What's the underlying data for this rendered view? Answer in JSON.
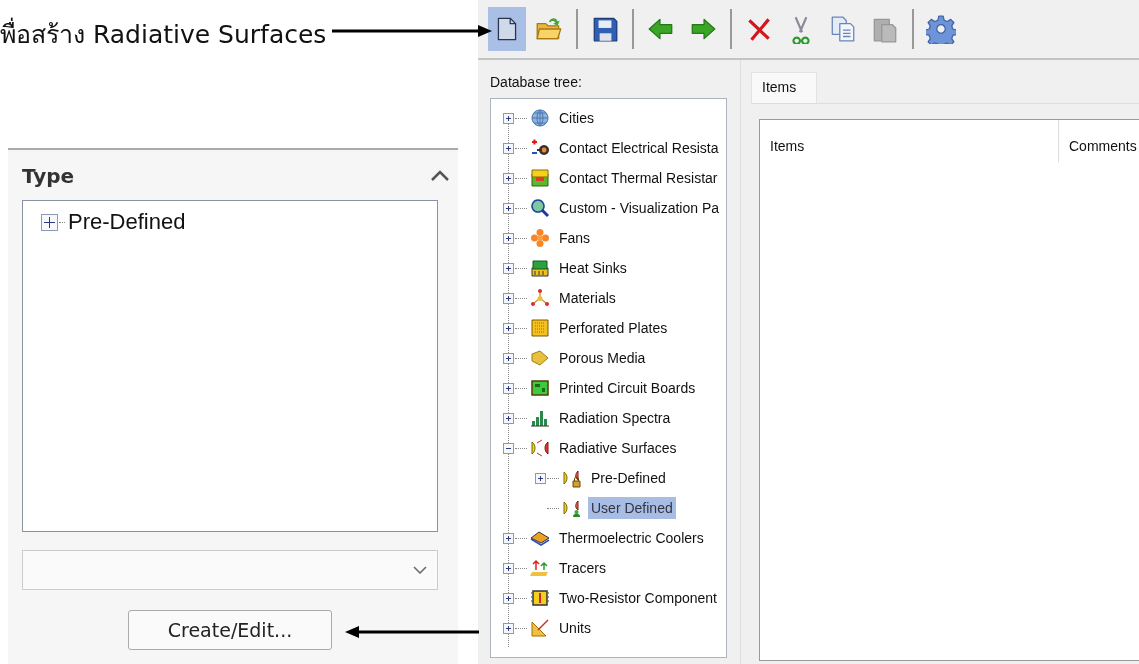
{
  "caption": {
    "text": "พื่อสร้าง Radiative Surfaces"
  },
  "type_panel": {
    "title": "Type",
    "expanded": true,
    "tree": [
      {
        "label": "Pre-Defined",
        "expanded": false
      }
    ],
    "button": "Create/Edit..."
  },
  "toolbar": [
    {
      "kind": "new",
      "selected": true,
      "disabled": false
    },
    {
      "kind": "open",
      "selected": false,
      "disabled": false
    },
    {
      "kind": "separator"
    },
    {
      "kind": "save",
      "selected": false,
      "disabled": false
    },
    {
      "kind": "separator"
    },
    {
      "kind": "back",
      "selected": false,
      "disabled": false
    },
    {
      "kind": "forward",
      "selected": false,
      "disabled": false
    },
    {
      "kind": "separator"
    },
    {
      "kind": "delete",
      "selected": false,
      "disabled": false
    },
    {
      "kind": "cut",
      "selected": false,
      "disabled": false
    },
    {
      "kind": "copy",
      "selected": false,
      "disabled": false
    },
    {
      "kind": "paste",
      "selected": false,
      "disabled": true
    },
    {
      "kind": "separator"
    },
    {
      "kind": "settings",
      "selected": false,
      "disabled": false
    }
  ],
  "database_tree": {
    "label": "Database tree:",
    "items": [
      {
        "label": "Cities",
        "kind": "globe",
        "expanded": false,
        "selected": false
      },
      {
        "label": "Contact Electrical Resista",
        "kind": "terminal",
        "expanded": false,
        "selected": false
      },
      {
        "label": "Contact Thermal Resistar",
        "kind": "box",
        "expanded": false,
        "selected": false
      },
      {
        "label": "Custom - Visualization Pa",
        "kind": "magnifier",
        "expanded": false,
        "selected": false
      },
      {
        "label": "Fans",
        "kind": "fan",
        "expanded": false,
        "selected": false
      },
      {
        "label": "Heat Sinks",
        "kind": "heatsink",
        "expanded": false,
        "selected": false
      },
      {
        "label": "Materials",
        "kind": "molecule",
        "expanded": false,
        "selected": false
      },
      {
        "label": "Perforated Plates",
        "kind": "plate",
        "expanded": false,
        "selected": false
      },
      {
        "label": "Porous Media",
        "kind": "wedge",
        "expanded": false,
        "selected": false
      },
      {
        "label": "Printed Circuit Boards",
        "kind": "board",
        "expanded": false,
        "selected": false
      },
      {
        "label": "Radiation Spectra",
        "kind": "bars",
        "expanded": false,
        "selected": false
      },
      {
        "label": "Radiative Surfaces",
        "kind": "reflector",
        "expanded": true,
        "selected": false,
        "children": [
          {
            "label": "Pre-Defined",
            "kind": "reflector-lock",
            "expanded": false,
            "selected": false
          },
          {
            "label": "User Defined",
            "kind": "reflector-user",
            "selected": true
          }
        ]
      },
      {
        "label": "Thermoelectric Coolers",
        "kind": "cooler",
        "expanded": false,
        "selected": false
      },
      {
        "label": "Tracers",
        "kind": "arrows",
        "expanded": false,
        "selected": false
      },
      {
        "label": "Two-Resistor Component",
        "kind": "chip",
        "expanded": false,
        "selected": false
      },
      {
        "label": "Units",
        "kind": "square",
        "expanded": false,
        "selected": false
      }
    ]
  },
  "tabs": [
    {
      "label": "Items",
      "selected": true
    }
  ],
  "items_table": {
    "columns": [
      "Items",
      "Comments"
    ]
  }
}
